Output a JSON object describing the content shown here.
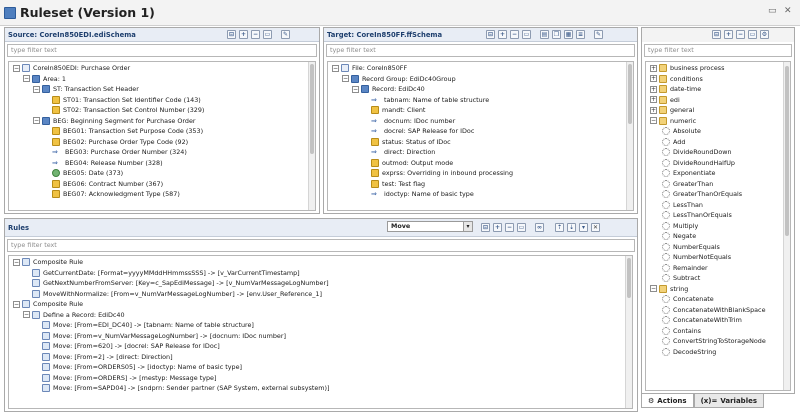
{
  "window": {
    "title": "Ruleset (Version 1)"
  },
  "source": {
    "title": "Source: CoreIn850EDI.ediSchema",
    "filter_placeholder": "type filter text",
    "items": [
      {
        "label": "CoreIn850EDI: Purchase Order"
      },
      {
        "label": "Area: 1"
      },
      {
        "label": "ST: Transaction Set Header"
      },
      {
        "label": "ST01: Transaction Set Identifier Code (143)"
      },
      {
        "label": "ST02: Transaction Set Control Number (329)"
      },
      {
        "label": "BEG: Beginning Segment for Purchase Order"
      },
      {
        "label": "BEG01: Transaction Set Purpose Code (353)"
      },
      {
        "label": "BEG02: Purchase Order Type Code (92)"
      },
      {
        "label": "BEG03: Purchase Order Number (324)"
      },
      {
        "label": "BEG04: Release Number (328)"
      },
      {
        "label": "BEG05: Date (373)"
      },
      {
        "label": "BEG06: Contract Number (367)"
      },
      {
        "label": "BEG07: Acknowledgment Type (587)"
      }
    ]
  },
  "target": {
    "title": "Target: CoreIn850FF.ffSchema",
    "filter_placeholder": "type filter text",
    "items": [
      {
        "label": "File: CoreIn850FF"
      },
      {
        "label": "Record Group: EdiDc40Group"
      },
      {
        "label": "Record: EdiDc40"
      },
      {
        "label": "tabnam: Name of table structure"
      },
      {
        "label": "mandt: Client"
      },
      {
        "label": "docnum: IDoc number"
      },
      {
        "label": "docrel: SAP Release for IDoc"
      },
      {
        "label": "status: Status of IDoc"
      },
      {
        "label": "direct: Direction"
      },
      {
        "label": "outmod: Output mode"
      },
      {
        "label": "exprss: Overriding in inbound processing"
      },
      {
        "label": "test: Test flag"
      },
      {
        "label": "idoctyp: Name of basic type"
      }
    ]
  },
  "rules": {
    "title": "Rules",
    "mode_value": "Move",
    "filter_placeholder": "type filter text",
    "items": [
      {
        "label": "Composite Rule"
      },
      {
        "label": "GetCurrentDate: [Format=yyyyMMddHHmmssSSS] -> [v_VarCurrentTimestamp]"
      },
      {
        "label": "GetNextNumberFromServer: [Key=c_SapEdiMessage] -> [v_NumVarMessageLogNumber]"
      },
      {
        "label": "MoveWithNormalize: [From=v_NumVarMessageLogNumber] -> [env.User_Reference_1]"
      },
      {
        "label": "Composite Rule"
      },
      {
        "label": "Define a Record: EdiDc40"
      },
      {
        "label": "Move: [From=EDI_DC40] -> [tabnam: Name of table structure]"
      },
      {
        "label": "Move: [From=v_NumVarMessageLogNumber] -> [docnum: IDoc number]"
      },
      {
        "label": "Move: [From=620] -> [docrel: SAP Release for IDoc]"
      },
      {
        "label": "Move: [From=2] -> [direct: Direction]"
      },
      {
        "label": "Move: [From=ORDERS05] -> [idoctyp: Name of basic type]"
      },
      {
        "label": "Move: [From=ORDERS] -> [mestyp: Message type]"
      },
      {
        "label": "Move: [From=SAPD04] -> [sndprn: Sender partner (SAP System, external subsystem)]"
      }
    ]
  },
  "actions": {
    "filter_placeholder": "type filter text",
    "items": [
      {
        "label": "business process"
      },
      {
        "label": "conditions"
      },
      {
        "label": "date-time"
      },
      {
        "label": "edi"
      },
      {
        "label": "general"
      },
      {
        "label": "numeric"
      },
      {
        "label": "Absolute"
      },
      {
        "label": "Add"
      },
      {
        "label": "DivideRoundDown"
      },
      {
        "label": "DivideRoundHalfUp"
      },
      {
        "label": "Exponentiate"
      },
      {
        "label": "GreaterThan"
      },
      {
        "label": "GreaterThanOrEquals"
      },
      {
        "label": "LessThan"
      },
      {
        "label": "LessThanOrEquals"
      },
      {
        "label": "Multiply"
      },
      {
        "label": "Negate"
      },
      {
        "label": "NumberEquals"
      },
      {
        "label": "NumberNotEquals"
      },
      {
        "label": "Remainder"
      },
      {
        "label": "Subtract"
      },
      {
        "label": "string"
      },
      {
        "label": "Concatenate"
      },
      {
        "label": "ConcatenateWithBlankSpace"
      },
      {
        "label": "ConcatenateWithTrim"
      },
      {
        "label": "Contains"
      },
      {
        "label": "ConvertStringToStorageNode"
      },
      {
        "label": "DecodeString"
      }
    ],
    "tab_actions": "Actions",
    "tab_variables": "Variables"
  }
}
